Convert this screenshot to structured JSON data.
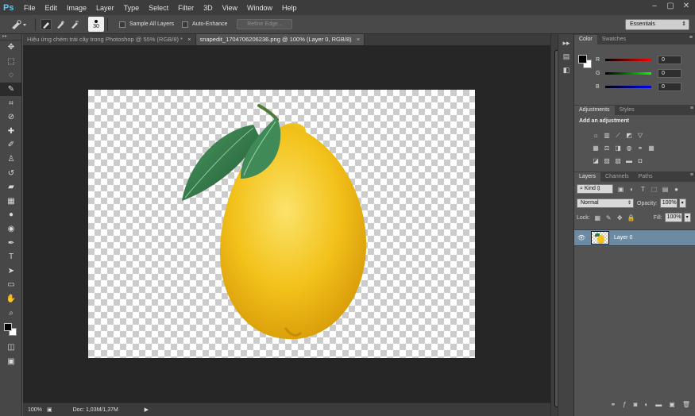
{
  "app": {
    "logo": "Ps"
  },
  "menu": [
    "File",
    "Edit",
    "Image",
    "Layer",
    "Type",
    "Select",
    "Filter",
    "3D",
    "View",
    "Window",
    "Help"
  ],
  "window_controls": {
    "minimize": "–",
    "maximize": "▢",
    "close": "✕"
  },
  "options_bar": {
    "brush_size": "30",
    "sample_all_layers": "Sample All Layers",
    "auto_enhance": "Auto-Enhance",
    "refine_edge": "Refine Edge...",
    "workspace": "Essentials"
  },
  "tools": [
    "move-tool",
    "marquee-tool",
    "lasso-tool",
    "quick-selection-tool",
    "crop-tool",
    "eyedropper-tool",
    "spot-healing-tool",
    "brush-tool",
    "clone-stamp-tool",
    "history-brush-tool",
    "eraser-tool",
    "gradient-tool",
    "blur-tool",
    "dodge-tool",
    "pen-tool",
    "type-tool",
    "path-selection-tool",
    "rectangle-tool",
    "hand-tool",
    "zoom-tool"
  ],
  "document_tabs": [
    {
      "label": "Hiệu ứng chém trái cây trong Photoshop @ 55% (RGB/8) *",
      "close": "×",
      "active": false
    },
    {
      "label": "snapedit_1704706206236.png @ 100% (Layer 0, RGB/8)",
      "close": "×",
      "active": true
    }
  ],
  "status": {
    "zoom": "100%",
    "doc": "Doc: 1,03M/1,37M",
    "arrow": "▶"
  },
  "color_panel": {
    "tabs": [
      "Color",
      "Swatches"
    ],
    "channels": [
      {
        "label": "R",
        "value": "0"
      },
      {
        "label": "G",
        "value": "0"
      },
      {
        "label": "B",
        "value": "0"
      }
    ]
  },
  "adjustments_panel": {
    "tabs": [
      "Adjustments",
      "Styles"
    ],
    "title": "Add an adjustment"
  },
  "layers_panel": {
    "tabs": [
      "Layers",
      "Channels",
      "Paths"
    ],
    "kind": "Kind",
    "blend_mode": "Normal",
    "opacity_label": "Opacity:",
    "opacity_value": "100%",
    "lock_label": "Lock:",
    "fill_label": "Fill:",
    "fill_value": "100%",
    "layers": [
      {
        "name": "Layer 0",
        "visible": true,
        "selected": true
      }
    ]
  },
  "colors": {
    "accent_selection": "#6d8aa3",
    "lemon": "#f3c21b",
    "leaf": "#2f7a43"
  }
}
